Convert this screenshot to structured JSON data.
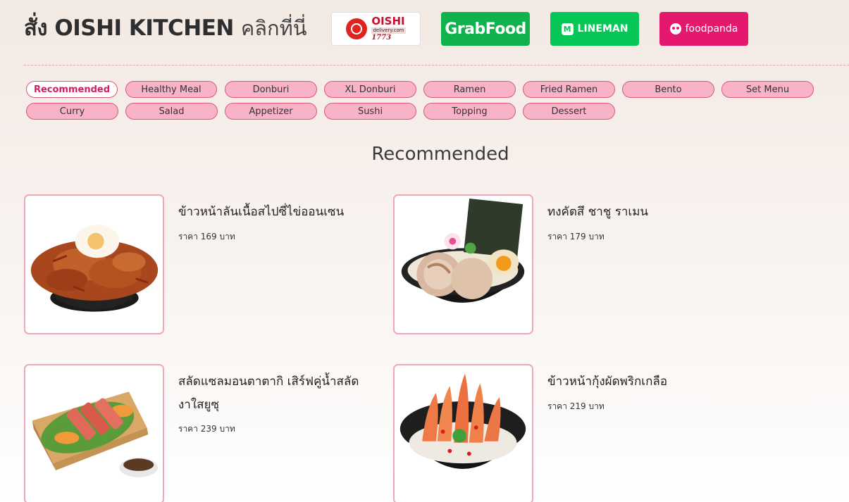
{
  "header": {
    "headline_bold": "สั่ง OISHI KITCHEN",
    "headline_light": "คลิกที่นี่",
    "partners": [
      {
        "name": "OISHI",
        "sub": "delivery.com",
        "number": "1773",
        "icon": "oishi-delivery-logo"
      },
      {
        "name": "GrabFood",
        "icon": "grabfood-logo"
      },
      {
        "name": "LINEMAN",
        "badge": "M",
        "icon": "lineman-logo"
      },
      {
        "name": "foodpanda",
        "icon": "foodpanda-logo"
      }
    ]
  },
  "categories": {
    "active": "Recommended",
    "items": [
      "Recommended",
      "Healthy Meal",
      "Donburi",
      "XL Donburi",
      "Ramen",
      "Fried Ramen",
      "Bento",
      "Set Menu",
      "Curry",
      "Salad",
      "Appetizer",
      "Sushi",
      "Topping",
      "Dessert"
    ]
  },
  "section": {
    "title": "Recommended"
  },
  "menu": [
    {
      "name": "ข้าวหน้าลันเนื้อสไปซี่ไข่ออนเซน",
      "price": "ราคา 169 บาท",
      "image": "spicy-beef-onsen-egg-donburi"
    },
    {
      "name": "ทงคัตสึ ชาชู ราเมน",
      "price": "ราคา 179 บาท",
      "image": "tonkotsu-chashu-ramen"
    },
    {
      "name": "สลัดแซลมอนตาตากิ เสิร์ฟคู่น้ำสลัดงาใสยูซุ",
      "price": "ราคา 239 บาท",
      "image": "salmon-tataki-salad"
    },
    {
      "name": "ข้าวหน้ากุ้งผัดพริกเกลือ",
      "price": "ราคา 219 บาท",
      "image": "salt-chili-shrimp-donburi"
    }
  ],
  "colors": {
    "pill_fill": "#f9b3c8",
    "pill_border": "#d9587c",
    "active_text": "#d21e5a",
    "card_border": "#f0a7b9",
    "grab": "#10b24b",
    "lineman": "#06c755",
    "foodpanda": "#e5186f"
  }
}
